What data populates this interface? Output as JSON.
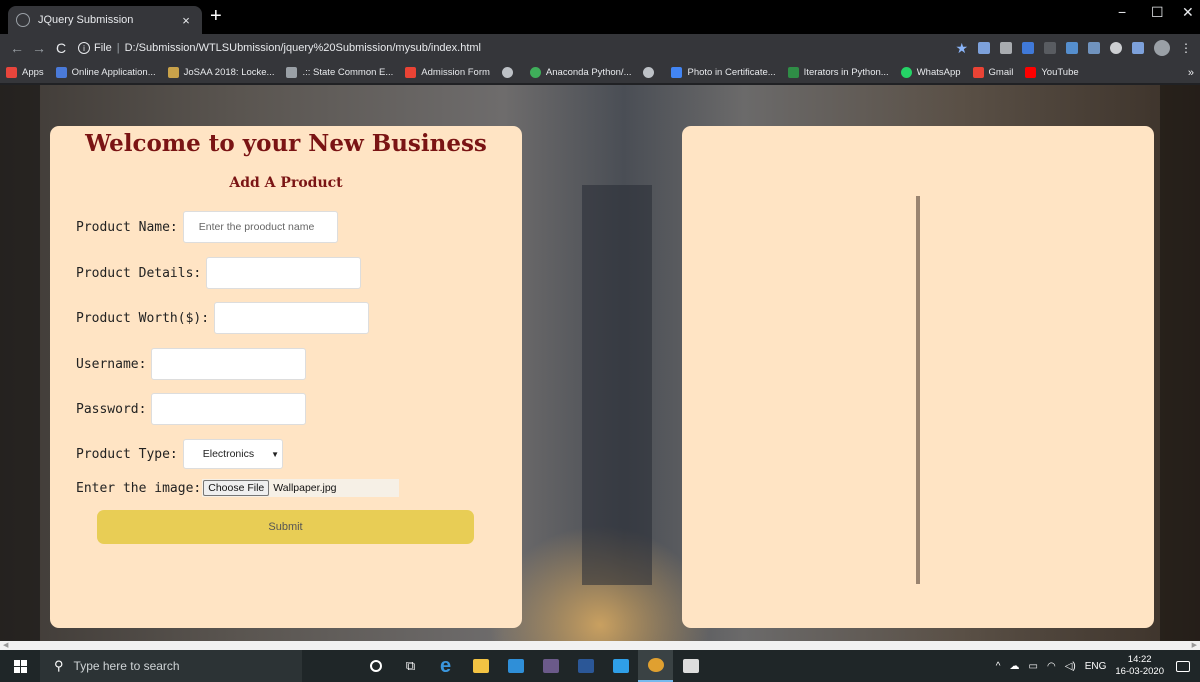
{
  "browser": {
    "tab_title": "JQuery Submission",
    "tab_close": "×",
    "new_tab": "+",
    "window_controls": {
      "minimize": "−",
      "maximize": "☐",
      "close": "✕"
    },
    "nav": {
      "back": "←",
      "forward": "→",
      "reload": "C"
    },
    "address": {
      "scheme_label": "File",
      "url": "D:/Submission/WTLSUbmission/jquery%20Submission/mysub/index.html"
    },
    "bookmarks": [
      {
        "label": "Apps",
        "color": "#e8453c"
      },
      {
        "label": "Online Application...",
        "color": "#4a7ad9"
      },
      {
        "label": "JoSAA 2018: Locke...",
        "color": "#c9a24a"
      },
      {
        "label": ".:: State Common E...",
        "color": "#9aa0a6"
      },
      {
        "label": "Admission Form",
        "color": "#ea4335"
      },
      {
        "label": "",
        "color": "#bdc1c6"
      },
      {
        "label": "Anaconda Python/...",
        "color": "#3fae5a"
      },
      {
        "label": "",
        "color": "#bdc1c6"
      },
      {
        "label": "Photo in Certificate...",
        "color": "#4285f4"
      },
      {
        "label": "Iterators in Python...",
        "color": "#2f8d46"
      },
      {
        "label": "WhatsApp",
        "color": "#25d366"
      },
      {
        "label": "Gmail",
        "color": "#ea4335"
      },
      {
        "label": "YouTube",
        "color": "#ff0000"
      }
    ],
    "bookmarks_more": "»"
  },
  "form": {
    "title": "Welcome to your New Business",
    "subtitle": "Add A Product",
    "product_name": {
      "label": "Product Name:",
      "placeholder": "Enter the prooduct name",
      "value": ""
    },
    "product_details": {
      "label": "Product Details:",
      "value": ""
    },
    "product_worth": {
      "label": "Product Worth($):",
      "value": ""
    },
    "username": {
      "label": "Username:",
      "value": ""
    },
    "password": {
      "label": "Password:",
      "value": ""
    },
    "product_type": {
      "label": "Product Type:",
      "selected": "Electronics",
      "caret": "▼"
    },
    "image": {
      "label": "Enter the image:",
      "button": "Choose File",
      "filename": "Wallpaper.jpg"
    },
    "submit": "Submit"
  },
  "colors": {
    "card_bg": "#ffe4c4",
    "title": "#7a1414",
    "submit_bg": "#e8cd55",
    "divider": "#9a8470"
  },
  "taskbar": {
    "search_placeholder": "Type here to search",
    "apps": [
      {
        "name": "cortana-icon",
        "color": "#ffffff"
      },
      {
        "name": "task-view-icon",
        "color": "#ffffff"
      },
      {
        "name": "edge-icon",
        "color": "#3a96dd"
      },
      {
        "name": "file-explorer-icon",
        "color": "#f3c343"
      },
      {
        "name": "mail-icon",
        "color": "#2f8fd8"
      },
      {
        "name": "winamp-icon",
        "color": "#6b5a8a"
      },
      {
        "name": "word-icon",
        "color": "#2b5797"
      },
      {
        "name": "vscode-icon",
        "color": "#2f9fe8"
      },
      {
        "name": "chrome-icon",
        "color": "#e0a030"
      },
      {
        "name": "photos-icon",
        "color": "#dddddd"
      }
    ],
    "tray": {
      "chevron": "^",
      "lang": "ENG"
    },
    "clock": {
      "time": "14:22",
      "date": "16-03-2020"
    }
  }
}
